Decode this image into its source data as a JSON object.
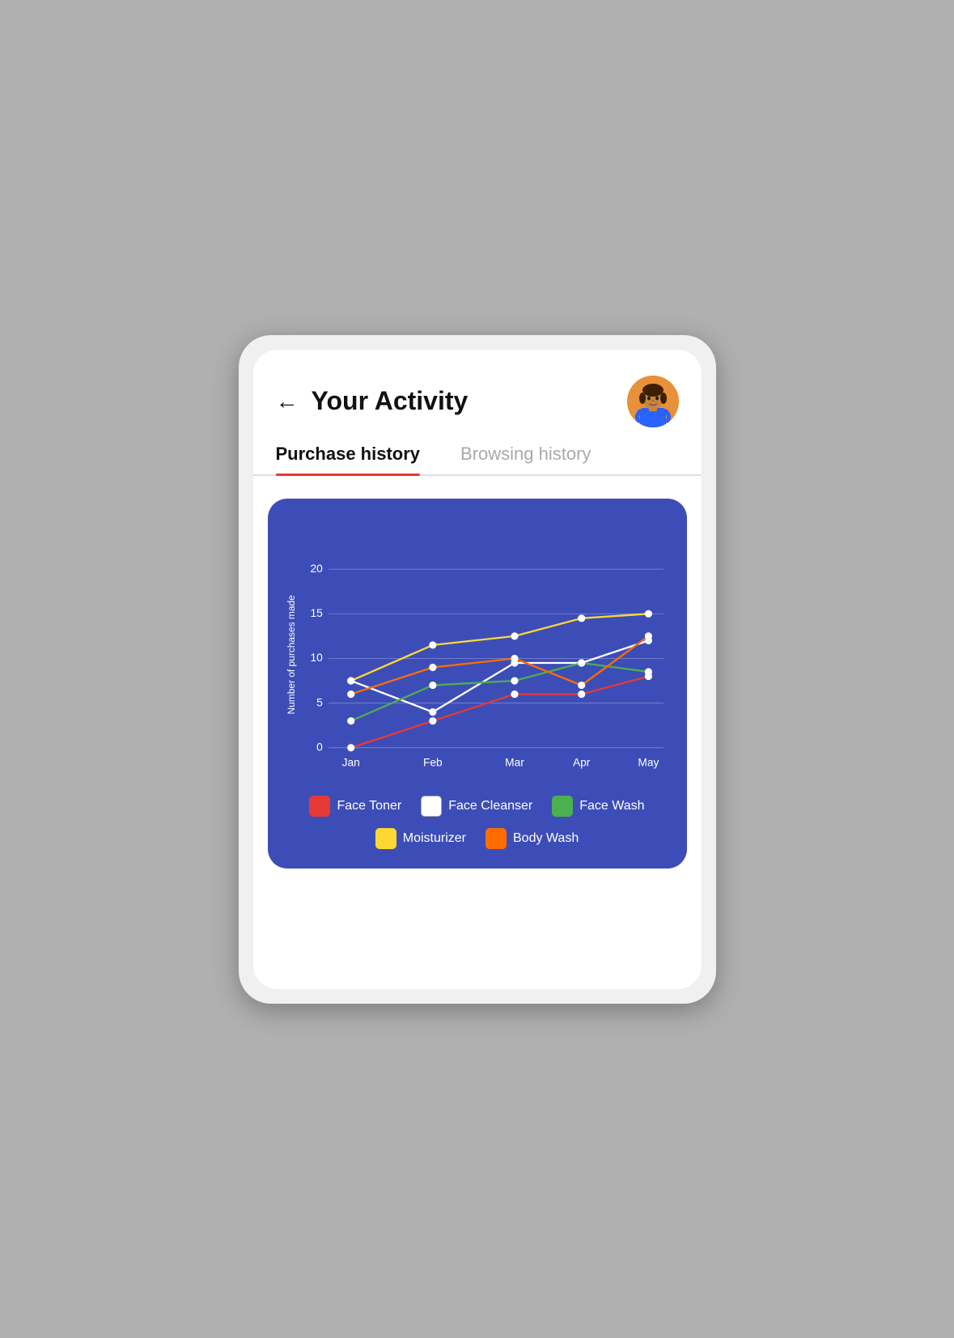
{
  "header": {
    "title": "Your Activity",
    "back_label": "←"
  },
  "tabs": [
    {
      "label": "Purchase history",
      "active": true,
      "id": "purchase"
    },
    {
      "label": "Browsing history",
      "active": false,
      "id": "browsing"
    }
  ],
  "chart": {
    "y_axis_label": "Number of purchases made",
    "y_ticks": [
      0,
      5,
      10,
      15,
      20
    ],
    "x_ticks": [
      "Jan",
      "Feb",
      "Mar",
      "Apr",
      "May"
    ],
    "series": [
      {
        "name": "Face Toner",
        "color": "#e53935",
        "points": [
          0,
          3,
          6,
          6,
          8
        ]
      },
      {
        "name": "Face Cleanser",
        "color": "#ffffff",
        "points": [
          7.5,
          4,
          9.5,
          9.5,
          12
        ]
      },
      {
        "name": "Face Wash",
        "color": "#4caf50",
        "points": [
          3,
          7,
          7.5,
          9.5,
          8.5
        ]
      },
      {
        "name": "Moisturizer",
        "color": "#fdd835",
        "points": [
          7.5,
          11.5,
          12.5,
          14.5,
          15
        ]
      },
      {
        "name": "Body Wash",
        "color": "#ff6d00",
        "points": [
          6,
          9,
          10,
          7,
          12.5
        ]
      }
    ]
  },
  "legend": [
    {
      "label": "Face Toner",
      "color": "#e53935"
    },
    {
      "label": "Face Cleanser",
      "color": "#ffffff"
    },
    {
      "label": "Face Wash",
      "color": "#4caf50"
    },
    {
      "label": "Moisturizer",
      "color": "#fdd835"
    },
    {
      "label": "Body Wash",
      "color": "#ff6d00"
    }
  ]
}
